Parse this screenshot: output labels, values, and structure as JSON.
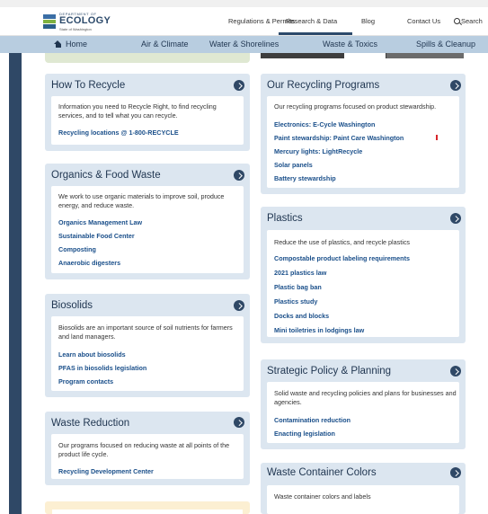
{
  "header": {
    "logo": {
      "dept": "DEPARTMENT OF",
      "name": "ECOLOGY",
      "state": "State of Washington"
    },
    "topnav": [
      {
        "label": "Regulations & Permits"
      },
      {
        "label": "Research & Data"
      },
      {
        "label": "Blog"
      },
      {
        "label": "Contact Us"
      }
    ],
    "search_label": "Search"
  },
  "mainnav": [
    {
      "label": "Home"
    },
    {
      "label": "Air & Climate"
    },
    {
      "label": "Water & Shorelines"
    },
    {
      "label": "Waste & Toxics"
    },
    {
      "label": "Spills & Cleanup"
    }
  ],
  "cards": {
    "recycle": {
      "title": "How To Recycle",
      "desc": "Information you need to Recycle Right, to find recycling services, and to tell what you can recycle.",
      "links": [
        "Recycling locations @ 1-800-RECYCLE"
      ]
    },
    "programs": {
      "title": "Our Recycling Programs",
      "desc": "Our recycling programs focused on product stewardship.",
      "links": [
        "Electronics: E-Cycle Washington",
        "Paint stewardship: Paint Care Washington",
        "Mercury lights: LightRecycle",
        "Solar panels",
        "Battery stewardship"
      ]
    },
    "organics": {
      "title": "Organics & Food Waste",
      "desc": "We work to use organic materials to improve soil, produce energy, and reduce waste.",
      "links": [
        "Organics Management Law",
        "Sustainable Food Center",
        "Composting",
        "Anaerobic digesters"
      ]
    },
    "plastics": {
      "title": "Plastics",
      "desc": "Reduce the use of plastics, and recycle plastics",
      "links": [
        "Compostable product labeling requirements",
        "2021 plastics law",
        "Plastic bag ban",
        "Plastics study",
        "Docks and blocks",
        "Mini toiletries in lodgings law"
      ]
    },
    "biosolids": {
      "title": "Biosolids",
      "desc": "Biosolids are an important source of soil nutrients for farmers and land managers.",
      "links": [
        "Learn about biosolids",
        "PFAS in biosolids legislation",
        "Program contacts"
      ]
    },
    "strategic": {
      "title": "Strategic Policy & Planning",
      "desc": "Solid waste and recycling policies and plans for businesses and agencies.",
      "links": [
        "Contamination reduction",
        "Enacting legislation"
      ]
    },
    "reduction": {
      "title": "Waste Reduction",
      "desc": "Our programs focused on reducing waste at all points of the product life cycle.",
      "links": [
        "Recycling Development Center"
      ]
    },
    "colors": {
      "title": "Waste Container Colors",
      "desc": "Waste container colors and labels"
    }
  },
  "colors": {
    "nav_blue": "#b8cde0",
    "card_blue": "#dce6f0",
    "dark_navy": "#2f4866",
    "link": "#1a4f8a"
  }
}
